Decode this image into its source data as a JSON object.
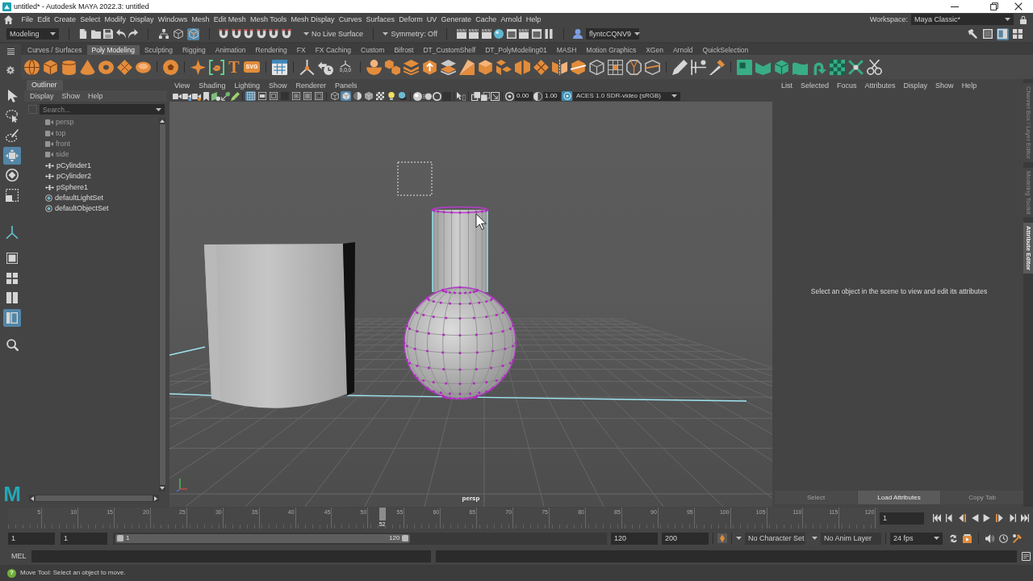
{
  "window": {
    "title": "untitled* - Autodesk MAYA 2022.3: untitled"
  },
  "menu_bar": {
    "items": [
      "File",
      "Edit",
      "Create",
      "Select",
      "Modify",
      "Display",
      "Windows",
      "Mesh",
      "Edit Mesh",
      "Mesh Tools",
      "Mesh Display",
      "Curves",
      "Surfaces",
      "Deform",
      "UV",
      "Generate",
      "Cache",
      "Arnold",
      "Help"
    ],
    "workspace_label": "Workspace:",
    "workspace": "Maya Classic*"
  },
  "status_line": {
    "menu_set": "Modeling",
    "select_modes": [
      {
        "kind": "hierarchy",
        "selected": false
      },
      {
        "kind": "object",
        "selected": false
      },
      {
        "kind": "component",
        "selected": true
      }
    ],
    "live_surface": "No Live Surface",
    "symmetry": "Symmetry: Off",
    "user": "flyntcCQNV9",
    "panel_toggles": [
      {
        "kind": "toolkit",
        "on": false
      },
      {
        "kind": "attributes",
        "on": false
      },
      {
        "kind": "channels",
        "on": true
      },
      {
        "kind": "layout",
        "on": false
      }
    ]
  },
  "shelf": {
    "tabs": [
      {
        "label": "Curves / Surfaces",
        "selected": false
      },
      {
        "label": "Poly Modeling",
        "selected": true
      },
      {
        "label": "Sculpting",
        "selected": false
      },
      {
        "label": "Rigging",
        "selected": false
      },
      {
        "label": "Animation",
        "selected": false
      },
      {
        "label": "Rendering",
        "selected": false
      },
      {
        "label": "FX",
        "selected": false
      },
      {
        "label": "FX Caching",
        "selected": false
      },
      {
        "label": "Custom",
        "selected": false
      },
      {
        "label": "Bifrost",
        "selected": false
      },
      {
        "label": "DT_CustomShelf",
        "selected": false
      },
      {
        "label": "DT_PolyModeling01",
        "selected": false
      },
      {
        "label": "MASH",
        "selected": false
      },
      {
        "label": "Motion Graphics",
        "selected": false
      },
      {
        "label": "XGen",
        "selected": false
      },
      {
        "label": "Arnold",
        "selected": false
      },
      {
        "label": "QuickSelection",
        "selected": false
      }
    ],
    "type_tool": "T",
    "svg_tool": "SVG",
    "axes_caption": "0,0,0"
  },
  "toolbox": {
    "tools": [
      {
        "kind": "select",
        "selected": false
      },
      {
        "kind": "lasso",
        "selected": false
      },
      {
        "kind": "paint",
        "selected": false
      },
      {
        "kind": "move",
        "selected": true
      },
      {
        "kind": "rotate",
        "selected": false
      },
      {
        "kind": "scale",
        "selected": false
      }
    ],
    "layouts": [
      {
        "kind": "single",
        "selected": false
      },
      {
        "kind": "four",
        "selected": false
      },
      {
        "kind": "two",
        "selected": false
      },
      {
        "kind": "split",
        "selected": true
      }
    ],
    "logo": "M"
  },
  "outliner": {
    "title": "Outliner",
    "menus": [
      "Display",
      "Show",
      "Help"
    ],
    "search_placeholder": "Search...",
    "items": [
      {
        "label": "persp",
        "kind": "camera",
        "hidden": true
      },
      {
        "label": "top",
        "kind": "camera",
        "hidden": true
      },
      {
        "label": "front",
        "kind": "camera",
        "hidden": true
      },
      {
        "label": "side",
        "kind": "camera",
        "hidden": true
      },
      {
        "label": "pCylinder1",
        "kind": "transform",
        "hidden": false
      },
      {
        "label": "pCylinder2",
        "kind": "transform",
        "hidden": false
      },
      {
        "label": "pSphere1",
        "kind": "transform",
        "hidden": false
      },
      {
        "label": "defaultLightSet",
        "kind": "set",
        "hidden": false
      },
      {
        "label": "defaultObjectSet",
        "kind": "set",
        "hidden": false
      }
    ]
  },
  "viewport": {
    "menus": [
      "View",
      "Shading",
      "Lighting",
      "Show",
      "Renderer",
      "Panels"
    ],
    "gate_toggles": [
      {
        "kind": "grid",
        "on": true
      },
      {
        "kind": "film_gate",
        "on": false
      },
      {
        "kind": "resolution_gate",
        "on": false
      },
      {
        "kind": "gate_mask",
        "on": false
      },
      {
        "kind": "field_chart",
        "on": false
      },
      {
        "kind": "safe_action",
        "on": false
      },
      {
        "kind": "safe_title",
        "on": false
      }
    ],
    "shading_modes": [
      {
        "kind": "wireframe",
        "selected": false
      },
      {
        "kind": "shaded",
        "selected": true
      },
      {
        "kind": "default_material",
        "selected": false
      },
      {
        "kind": "wireframe_on_shaded",
        "selected": false
      },
      {
        "kind": "textured",
        "selected": false
      },
      {
        "kind": "lights",
        "selected": false
      },
      {
        "kind": "shadows",
        "selected": false
      }
    ],
    "exposure": "0.00",
    "gamma": "1.00",
    "color_management": {
      "on": true,
      "view_transform": "ACES 1.0 SDR-video (sRGB)"
    },
    "camera": "persp"
  },
  "attribute_editor": {
    "menus": [
      "List",
      "Selected",
      "Focus",
      "Attributes",
      "Display",
      "Show",
      "Help"
    ],
    "message": "Select an object in the scene to view and edit its attributes",
    "buttons": [
      {
        "label": "Select",
        "disabled": true
      },
      {
        "label": "Load Attributes",
        "disabled": false
      },
      {
        "label": "Copy Tab",
        "disabled": true
      }
    ]
  },
  "side_tabs": [
    {
      "label": "Channel Box / Layer Editor",
      "selected": false
    },
    {
      "label": "Modeling Toolkit",
      "selected": false
    },
    {
      "label": "Attribute Editor",
      "selected": true
    }
  ],
  "time_slider": {
    "frame_labels": [
      "5",
      "10",
      "15",
      "20",
      "25",
      "30",
      "35",
      "40",
      "45",
      "50",
      "55",
      "60",
      "65",
      "70",
      "75",
      "80",
      "85",
      "90",
      "95",
      "100",
      "105",
      "110",
      "115",
      "120"
    ],
    "playhead": {
      "label": "52",
      "level": 0.43
    },
    "current_frame": "1"
  },
  "range_slider": {
    "animation_start": "1",
    "playback_start": "1",
    "range_start": "1",
    "range_end": "120",
    "level": 0.6,
    "playback_end": "120",
    "animation_end": "200",
    "character_set": "No Character Set",
    "anim_layer": "No Anim Layer",
    "fps": "24 fps"
  },
  "command_line": {
    "language": "MEL"
  },
  "help_line": {
    "icon": "?",
    "text": "Move Tool: Select an object to move."
  }
}
